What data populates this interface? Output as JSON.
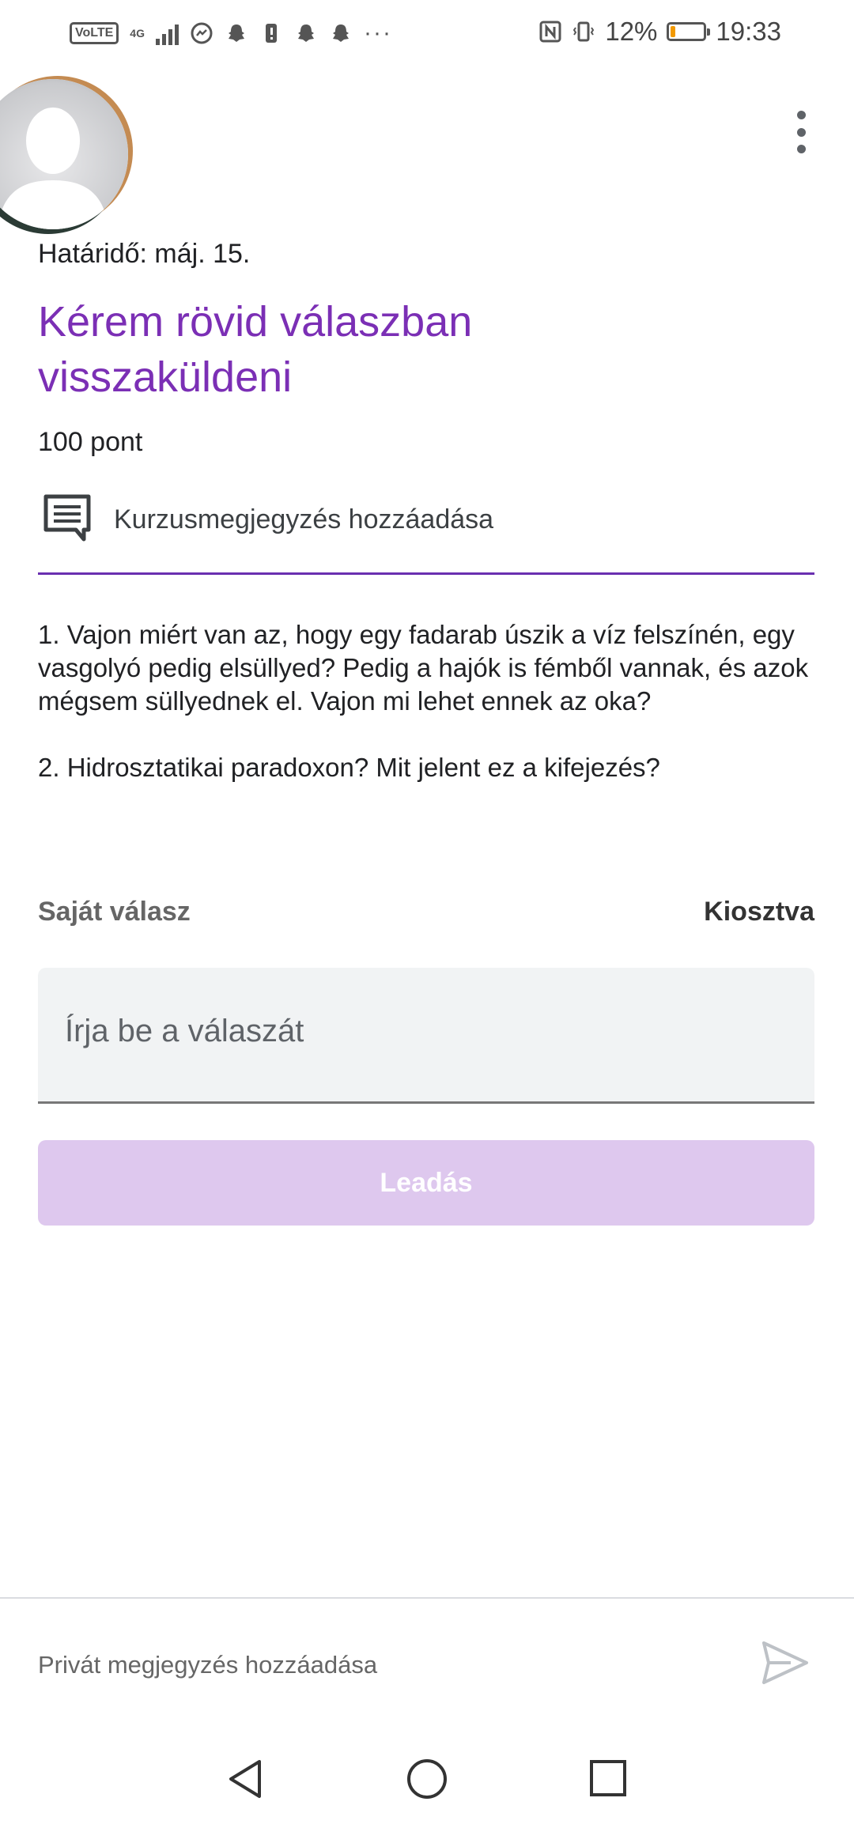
{
  "status_bar": {
    "network_badge": "VoLTE",
    "network_type": "4G",
    "battery_percent": "12%",
    "battery_level": 0.12,
    "time": "19:33",
    "more_notifications": "···",
    "icons": [
      "messenger-icon",
      "snapchat-icon",
      "alert-icon",
      "snapchat-icon",
      "snapchat-icon",
      "nfc-icon",
      "vibrate-icon"
    ]
  },
  "assignment": {
    "due": "Határidő: máj. 15.",
    "title": "Kérem rövid válaszban visszaküldeni",
    "points": "100 pont",
    "class_comment": "Kurzusmegjegyzés hozzáadása",
    "description": "1. Vajon miért van az, hogy egy fadarab úszik a víz felszínén, egy vasgolyó pedig elsüllyed? Pedig a hajók is fémből vannak, és azok mégsem süllyednek el. Vajon mi lehet ennek az oka?\n\n2. Hidrosztatikai paradoxon? Mit jelent ez a kifejezés?"
  },
  "work": {
    "label": "Saját válasz",
    "status": "Kiosztva",
    "answer_value": "",
    "answer_placeholder": "Írja be a válaszát",
    "submit_label": "Leadás"
  },
  "private_comment": {
    "placeholder": "Privát megjegyzés hozzáadása"
  },
  "colors": {
    "accent": "#7b2fb5",
    "submit_disabled": "#dec8ee",
    "battery_low": "#f29900"
  }
}
